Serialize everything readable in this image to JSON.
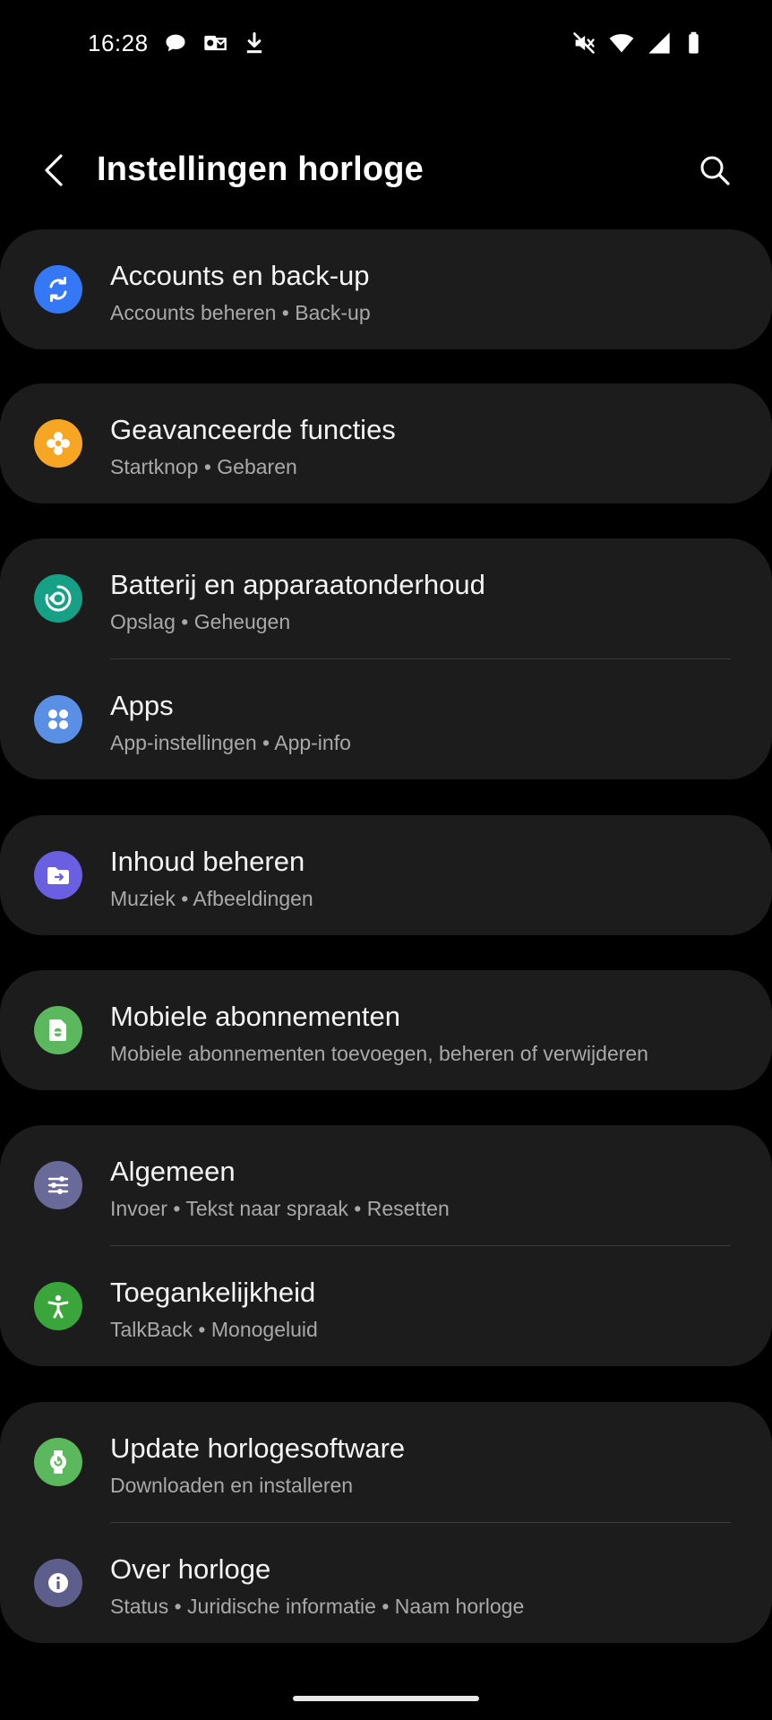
{
  "status_bar": {
    "time": "16:28",
    "left_icons": [
      "chat-bubble-icon",
      "outlook-mail-icon",
      "download-icon"
    ],
    "right_icons": [
      "mute-icon",
      "wifi-icon",
      "signal-icon",
      "battery-icon"
    ]
  },
  "header": {
    "title": "Instellingen horloge",
    "back_icon": "back-arrow-icon",
    "search_icon": "search-icon"
  },
  "cards": [
    {
      "items": [
        {
          "title": "Accounts en back-up",
          "subtitle": "Accounts beheren • Back-up",
          "icon": "sync-icon",
          "color": "#3478f6"
        }
      ]
    },
    {
      "items": [
        {
          "title": "Geavanceerde functies",
          "subtitle": "Startknop • Gebaren",
          "icon": "gear-flower-icon",
          "color": "#f6a623"
        }
      ]
    },
    {
      "items": [
        {
          "title": "Batterij en apparaatonderhoud",
          "subtitle": "Opslag • Geheugen",
          "icon": "device-care-icon",
          "color": "#16a085"
        },
        {
          "title": "Apps",
          "subtitle": "App-instellingen • App-info",
          "icon": "apps-grid-icon",
          "color": "#5a8fe6"
        }
      ]
    },
    {
      "items": [
        {
          "title": "Inhoud beheren",
          "subtitle": "Muziek • Afbeeldingen",
          "icon": "folder-icon",
          "color": "#6a5fe0"
        }
      ]
    },
    {
      "items": [
        {
          "title": "Mobiele abonnementen",
          "subtitle": "Mobiele abonnementen toevoegen, beheren of verwijderen",
          "icon": "esim-icon",
          "color": "#5cb85c"
        }
      ]
    },
    {
      "items": [
        {
          "title": "Algemeen",
          "subtitle": "Invoer • Tekst naar spraak • Resetten",
          "icon": "sliders-icon",
          "color": "#6a6a9a"
        },
        {
          "title": "Toegankelijkheid",
          "subtitle": "TalkBack • Monogeluid",
          "icon": "accessibility-icon",
          "color": "#3aa53a"
        }
      ]
    },
    {
      "items": [
        {
          "title": "Update horlogesoftware",
          "subtitle": "Downloaden en installeren",
          "icon": "watch-update-icon",
          "color": "#5cb85c"
        },
        {
          "title": "Over horloge",
          "subtitle": "Status • Juridische informatie • Naam horloge",
          "icon": "info-icon",
          "color": "#5e5e8c"
        }
      ]
    }
  ]
}
